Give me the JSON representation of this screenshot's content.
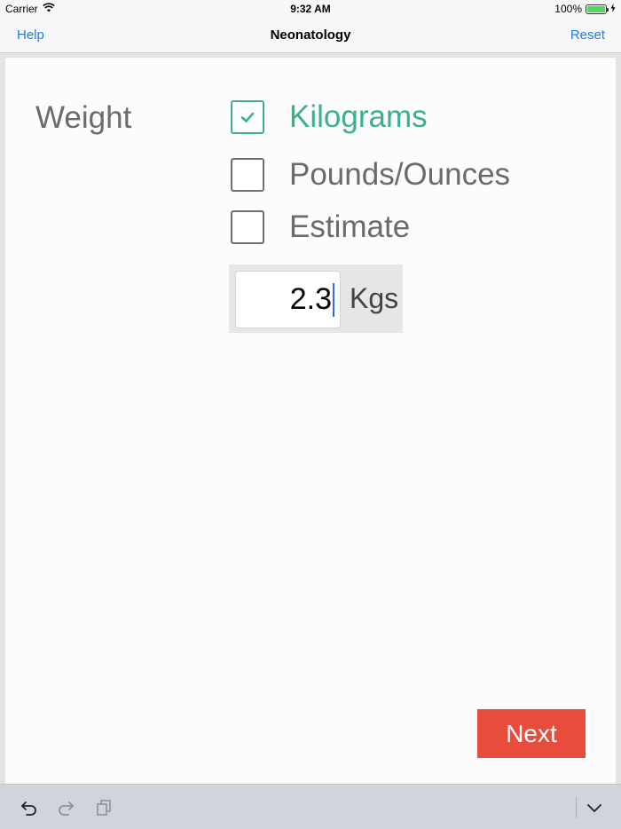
{
  "status_bar": {
    "carrier": "Carrier",
    "time": "9:32 AM",
    "battery": "100%",
    "battery_level": 1.0
  },
  "nav": {
    "left_label": "Help",
    "title": "Neonatology",
    "right_label": "Reset"
  },
  "form": {
    "field_label": "Weight",
    "options": [
      {
        "label": "Kilograms",
        "checked": true
      },
      {
        "label": "Pounds/Ounces",
        "checked": false
      },
      {
        "label": "Estimate",
        "checked": false
      }
    ],
    "input_value": "2.3",
    "unit_label": "Kgs"
  },
  "next_label": "Next",
  "colors": {
    "accent": "#3cae94",
    "next_button": "#e84c3d",
    "link": "#1a7ef5"
  },
  "toolbar": {
    "icons": [
      "undo-icon",
      "redo-icon",
      "paste-icon",
      "dismiss-keyboard-icon"
    ]
  }
}
